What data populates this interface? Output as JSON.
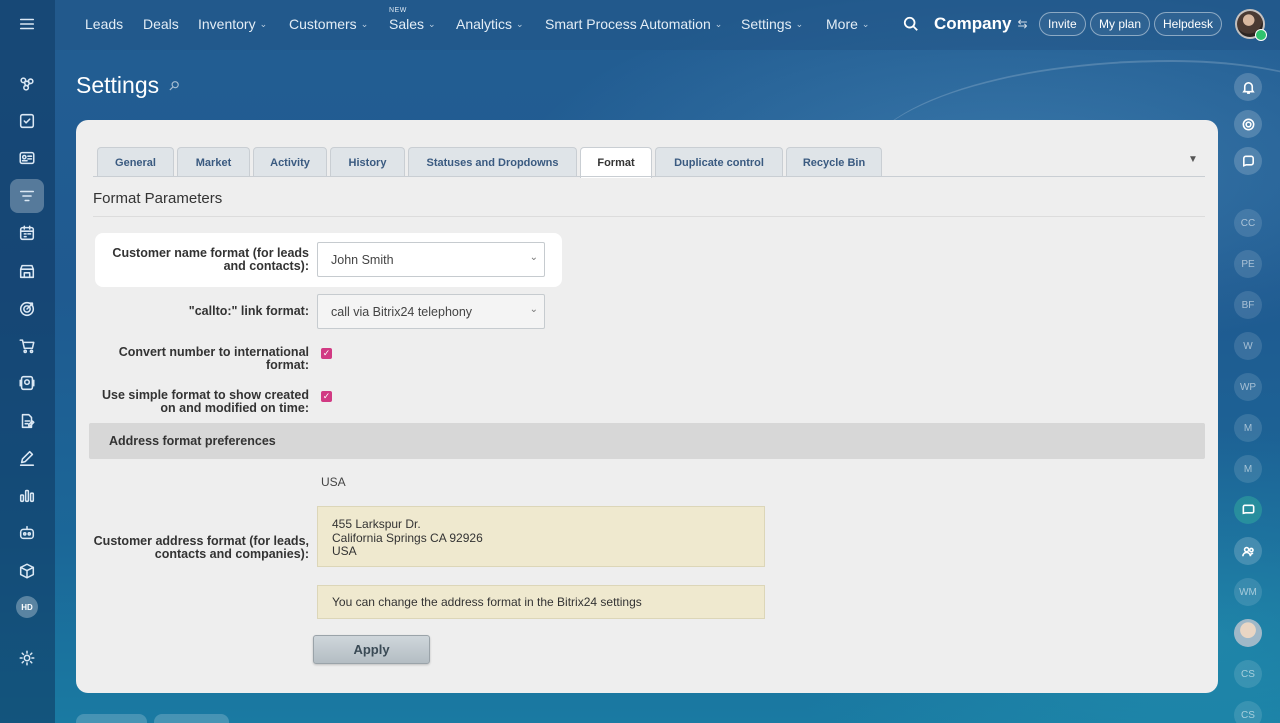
{
  "nav": {
    "items": [
      {
        "label": "Leads",
        "dropdown": false
      },
      {
        "label": "Deals",
        "dropdown": false
      },
      {
        "label": "Inventory",
        "dropdown": true
      },
      {
        "label": "Customers",
        "dropdown": true
      },
      {
        "label": "Sales",
        "dropdown": true,
        "badge": "NEW"
      },
      {
        "label": "Analytics",
        "dropdown": true
      },
      {
        "label": "Smart Process Automation",
        "dropdown": true
      },
      {
        "label": "Settings",
        "dropdown": true
      },
      {
        "label": "More",
        "dropdown": true
      }
    ],
    "company": "Company",
    "invite": "Invite",
    "my_plan": "My plan",
    "helpdesk": "Helpdesk"
  },
  "left_rail": {
    "icons": [
      "menu-icon",
      "crm-icon",
      "tasks-icon",
      "contacts-icon",
      "filter-icon",
      "calendar-icon",
      "store-icon",
      "target-icon",
      "cart-icon",
      "terminal-icon",
      "document-icon",
      "sign-icon",
      "analytics-icon",
      "robot-icon",
      "box-icon",
      "helpdesk-icon",
      "settings-icon"
    ],
    "hd_label": "HD"
  },
  "page": {
    "title": "Settings"
  },
  "tabs": [
    {
      "label": "General",
      "active": false
    },
    {
      "label": "Market",
      "active": false
    },
    {
      "label": "Activity",
      "active": false
    },
    {
      "label": "History",
      "active": false
    },
    {
      "label": "Statuses and Dropdowns",
      "active": false
    },
    {
      "label": "Format",
      "active": true
    },
    {
      "label": "Duplicate control",
      "active": false
    },
    {
      "label": "Recycle Bin",
      "active": false
    }
  ],
  "form": {
    "section_title": "Format Parameters",
    "name_format_label": "Customer name format (for leads and contacts):",
    "name_format_value": "John Smith",
    "callto_label": "\"callto:\" link format:",
    "callto_value": "call via Bitrix24 telephony",
    "convert_label": "Convert number to international format:",
    "convert_checked": true,
    "simple_time_label": "Use simple format to show created on and modified on time:",
    "simple_time_checked": true,
    "address_header": "Address format preferences",
    "country": "USA",
    "address_label": "Customer address format (for leads, contacts and companies):",
    "address_lines": [
      "455 Larkspur Dr.",
      "California Springs CA 92926",
      "USA"
    ],
    "info_text": "You can change the address format in the Bitrix24 settings",
    "apply_label": "Apply"
  },
  "right_rail": {
    "avatars": [
      "CC",
      "PE",
      "BF",
      "W",
      "WP",
      "M",
      "M",
      "WM",
      "CS",
      "CS"
    ]
  },
  "colors": {
    "accent_checkbox": "#d13a83",
    "online": "#2fc26e"
  }
}
